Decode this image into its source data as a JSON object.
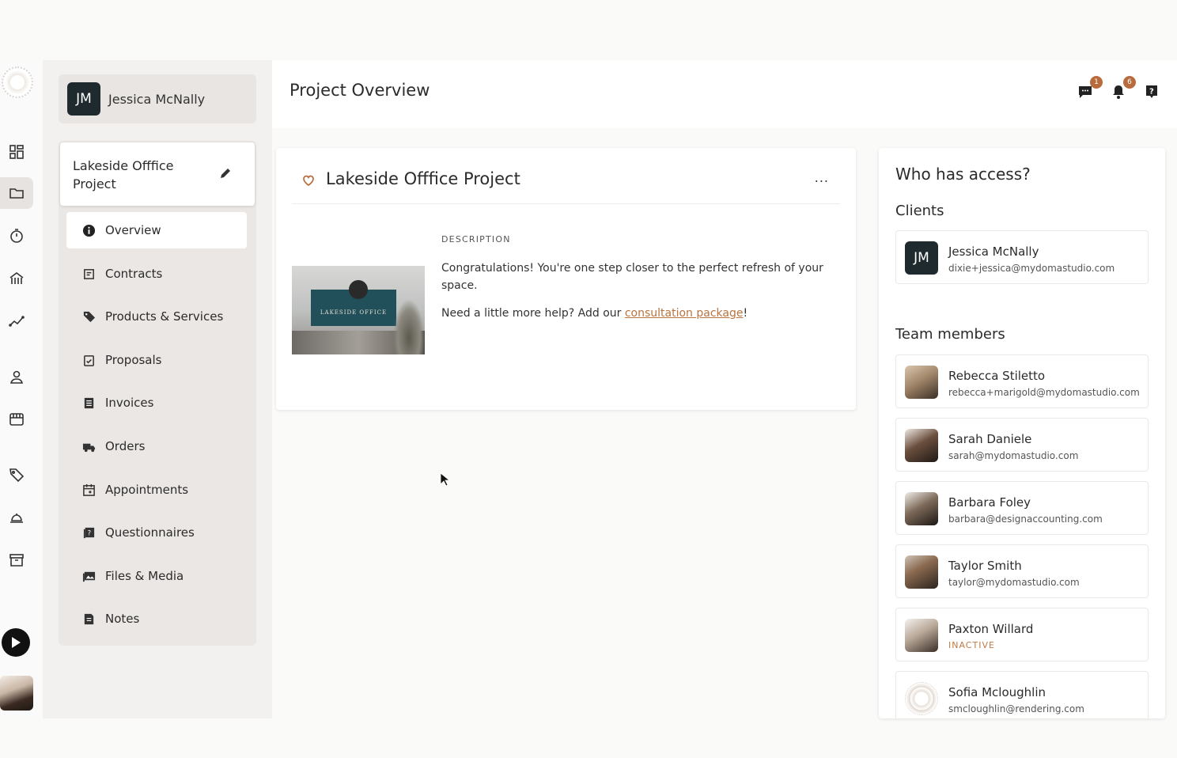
{
  "user": {
    "initials": "JM",
    "name": "Jessica McNally"
  },
  "header": {
    "title": "Project Overview",
    "messages_badge": "1",
    "notifications_badge": "6"
  },
  "rail": {
    "icons": [
      "dashboard-icon",
      "folder-icon",
      "timer-icon",
      "building-icon",
      "analytics-icon",
      "person-icon",
      "store-icon",
      "tag-icon",
      "service-icon",
      "archive-icon",
      "play-icon"
    ]
  },
  "project": {
    "name": "Lakeside Offfice Project"
  },
  "nav": {
    "items": [
      {
        "label": "Overview",
        "icon": "info-icon"
      },
      {
        "label": "Contracts",
        "icon": "contract-icon"
      },
      {
        "label": "Products & Services",
        "icon": "tag-icon"
      },
      {
        "label": "Proposals",
        "icon": "proposal-icon"
      },
      {
        "label": "Invoices",
        "icon": "invoice-icon"
      },
      {
        "label": "Orders",
        "icon": "truck-icon"
      },
      {
        "label": "Appointments",
        "icon": "calendar-icon"
      },
      {
        "label": "Questionnaires",
        "icon": "questionnaire-icon"
      },
      {
        "label": "Files & Media",
        "icon": "media-icon"
      },
      {
        "label": "Notes",
        "icon": "note-icon"
      }
    ]
  },
  "main": {
    "title": "Lakeside Offfice Project",
    "more": "...",
    "thumbnail_sign": "LAKESIDE OFFICE",
    "description_label": "DESCRIPTION",
    "description_p1": "Congratulations! You're one step closer to the perfect refresh of your space.",
    "description_p2_prefix": "Need a little more help? Add our ",
    "description_p2_link": "consultation package",
    "description_p2_suffix": "!"
  },
  "access": {
    "title": "Who has access?",
    "clients_heading": "Clients",
    "clients": [
      {
        "initials": "JM",
        "name": "Jessica McNally",
        "email": "dixie+jessica@mydomastudio.com"
      }
    ],
    "team_heading": "Team members",
    "team": [
      {
        "name": "Rebecca Stiletto",
        "email": "rebecca+marigold@mydomastudio.com"
      },
      {
        "name": "Sarah Daniele",
        "email": "sarah@mydomastudio.com"
      },
      {
        "name": "Barbara Foley",
        "email": "barbara@designaccounting.com"
      },
      {
        "name": "Taylor Smith",
        "email": "taylor@mydomastudio.com"
      },
      {
        "name": "Paxton Willard",
        "status": "INACTIVE"
      },
      {
        "name": "Sofia Mcloughlin",
        "email": "smcloughlin@rendering.com"
      }
    ]
  },
  "colors": {
    "accent": "#b86b3d",
    "avatar_bg": "#1f2a2e",
    "panel": "#f3f1ef"
  }
}
